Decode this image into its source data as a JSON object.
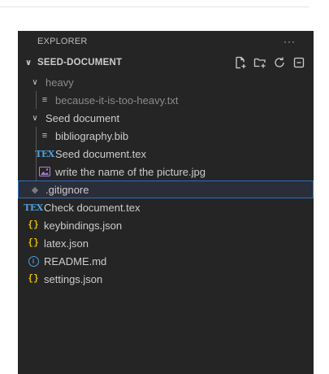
{
  "explorer": {
    "title": "EXPLORER",
    "more": "···"
  },
  "section": {
    "title": "SEED-DOCUMENT",
    "actions": [
      "new-file-icon",
      "new-folder-icon",
      "refresh-icon",
      "collapse-all-icon"
    ]
  },
  "tree": {
    "heavy_folder": "heavy",
    "heavy_file": "because-it-is-too-heavy.txt",
    "seed_folder": "Seed document",
    "bib_file": "bibliography.bib",
    "seed_tex": "Seed document.tex",
    "picture_file": "write the name of the picture.jpg",
    "gitignore": ".gitignore",
    "check_tex": "Check document.tex",
    "keybindings": "keybindings.json",
    "latex_json": "latex.json",
    "readme": "README.md",
    "settings": "settings.json"
  },
  "icons": {
    "tex_glyph": "TEX",
    "json_glyph": "{}",
    "info_glyph": "i",
    "lines_glyph": "≡",
    "git_glyph": "◆"
  },
  "colors": {
    "panel_bg": "#252526",
    "selection_border": "#2f6eba",
    "json_yellow": "#e5c000",
    "tex_blue": "#4fa0d8"
  }
}
